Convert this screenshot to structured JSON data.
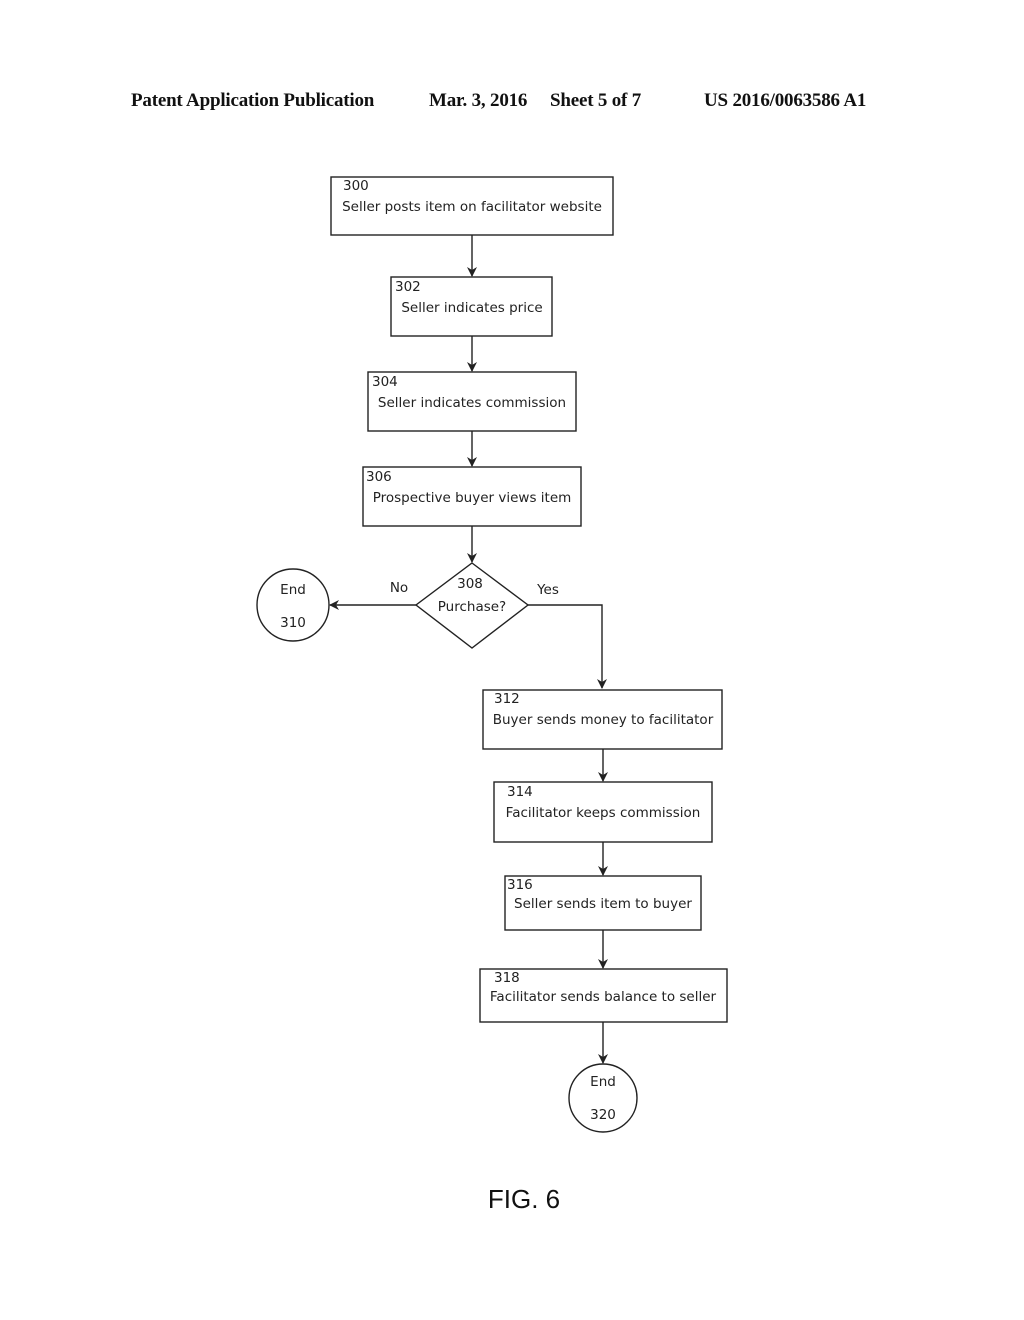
{
  "header": {
    "publication": "Patent Application Publication",
    "date": "Mar. 3, 2016",
    "sheet": "Sheet 5 of 7",
    "number": "US 2016/0063586 A1"
  },
  "flowchart": {
    "steps": [
      {
        "id": "300",
        "label": "Seller posts item on facilitator website"
      },
      {
        "id": "302",
        "label": "Seller indicates price"
      },
      {
        "id": "304",
        "label": "Seller indicates commission"
      },
      {
        "id": "306",
        "label": "Prospective buyer views item"
      },
      {
        "id": "308",
        "label": "Purchase?"
      },
      {
        "id": "310",
        "label": "End"
      },
      {
        "id": "312",
        "label": "Buyer sends money to facilitator"
      },
      {
        "id": "314",
        "label": "Facilitator keeps commission"
      },
      {
        "id": "316",
        "label": "Seller sends item to buyer"
      },
      {
        "id": "318",
        "label": "Facilitator sends balance to seller"
      },
      {
        "id": "320",
        "label": "End"
      }
    ],
    "branch_no": "No",
    "branch_yes": "Yes"
  },
  "figure_label": "FIG. 6"
}
